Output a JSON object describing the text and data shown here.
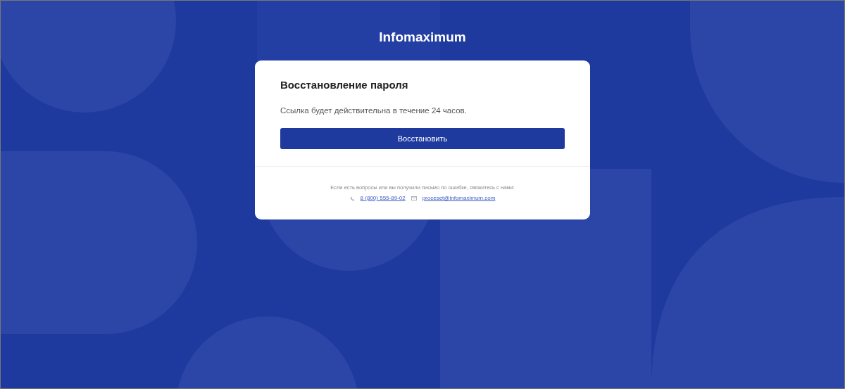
{
  "logo": "Infomaximum",
  "card": {
    "title": "Восстановление пароля",
    "text": "Ссылка будет действительна в течение 24 часов.",
    "button": "Восстановить",
    "footer": {
      "text": "Если есть вопросы или вы получили письмо по ошибке, свяжитесь с нами:",
      "phone": "8 (800) 555-89-02",
      "email": "proceset@infomaximum.com"
    }
  }
}
